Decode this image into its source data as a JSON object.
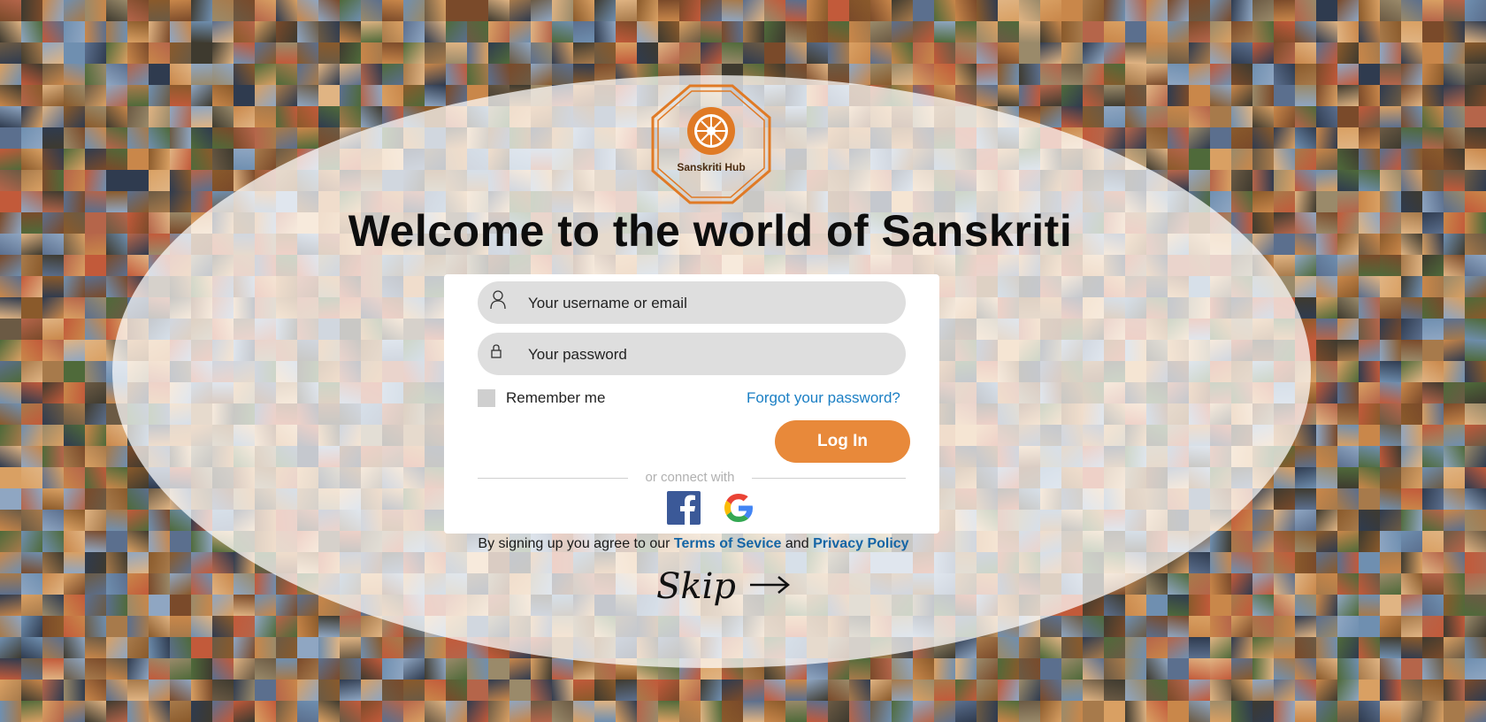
{
  "brand": {
    "logo_text": "Sanskriti Hub",
    "accent_color": "#e8893a",
    "logo_color": "#e07a25"
  },
  "welcome": {
    "title": "Welcome to the world of Sanskriti"
  },
  "login_form": {
    "username": {
      "placeholder": "Your username or email",
      "value": "",
      "icon": "user-icon"
    },
    "password": {
      "placeholder": "Your password",
      "value": "",
      "icon": "lock-icon"
    },
    "remember_label": "Remember me",
    "forgot_label": "Forgot your password?",
    "login_label": "Log In",
    "connect_label": "or connect with",
    "social": [
      {
        "name": "Facebook",
        "icon": "facebook-icon",
        "color": "#3b5998"
      },
      {
        "name": "Google",
        "icon": "google-icon"
      }
    ]
  },
  "terms": {
    "prefix": "By signing up you agree to our",
    "terms_label": "Terms of Sevice",
    "and": "and",
    "privacy_label": "Privacy Policy"
  },
  "skip": {
    "label": "Skip",
    "icon": "arrow-right-icon"
  },
  "background": {
    "description_icon": "temple-photo-mosaic"
  }
}
